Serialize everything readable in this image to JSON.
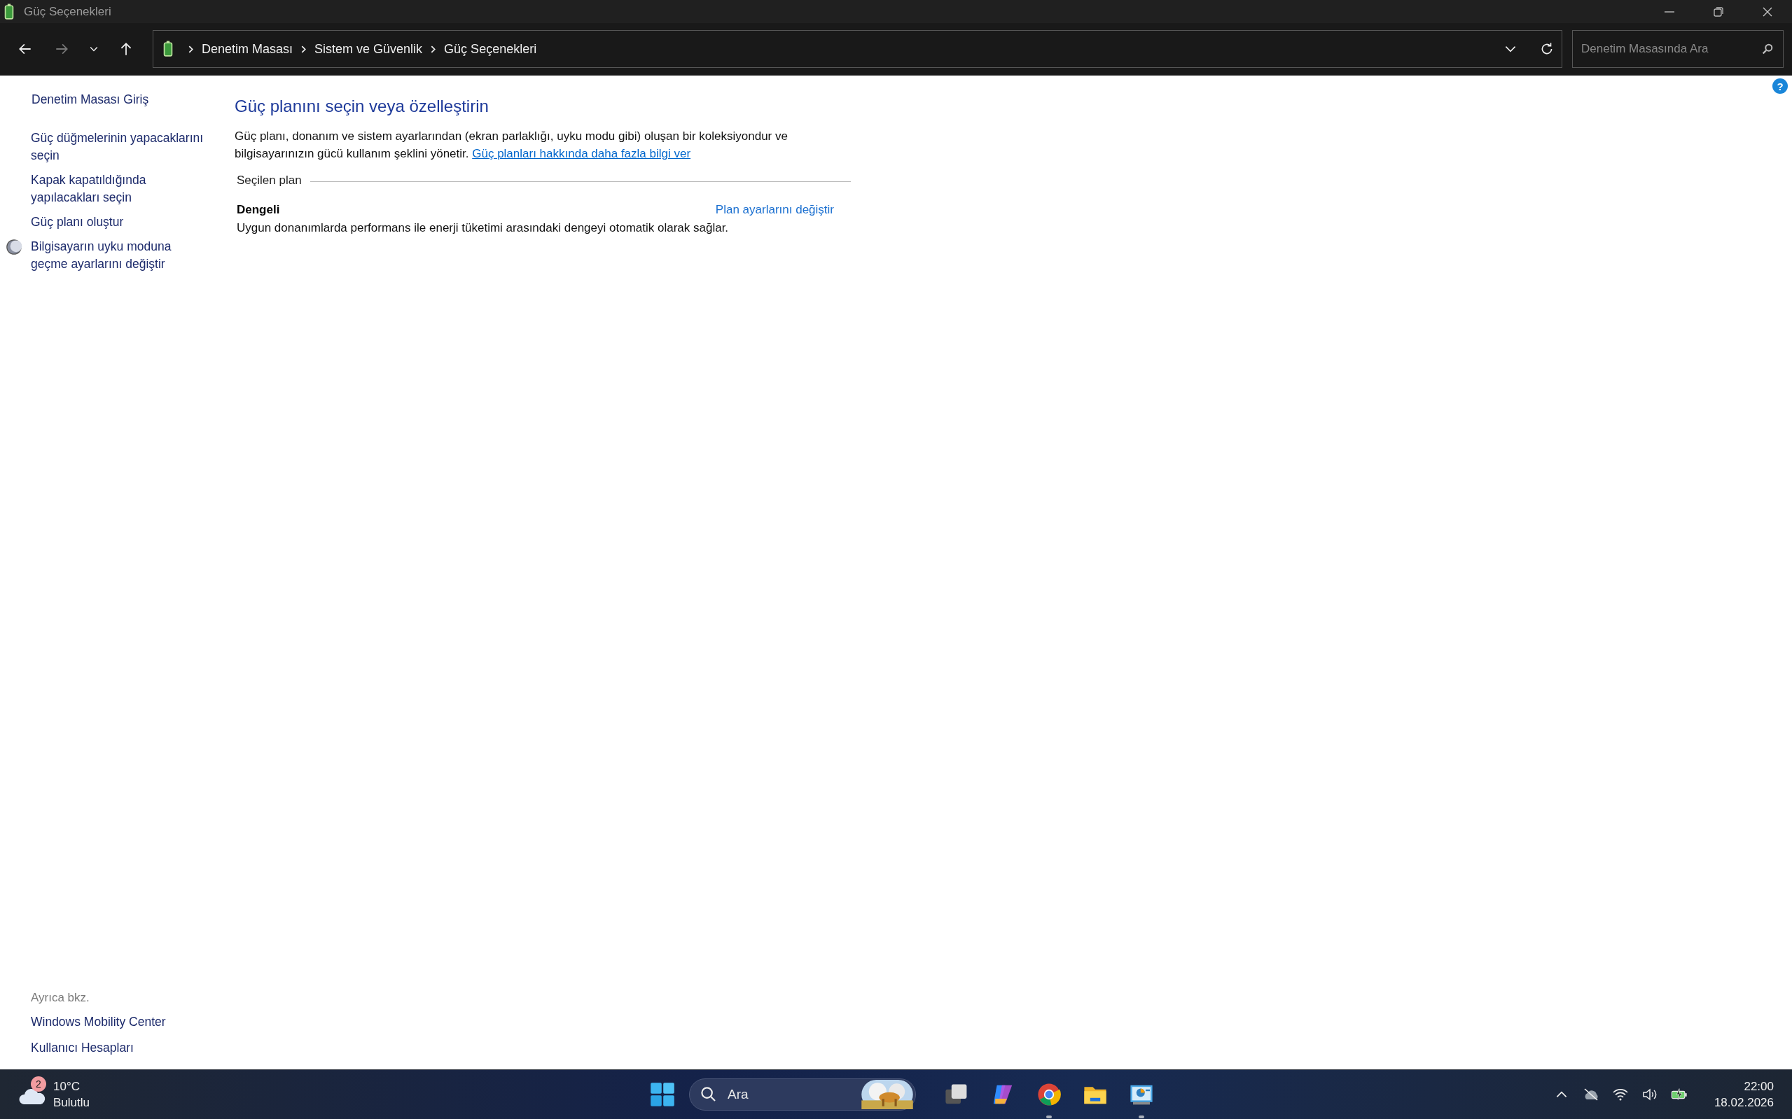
{
  "window": {
    "title": "Güç Seçenekleri"
  },
  "nav": {
    "forward_disabled": true,
    "breadcrumb": [
      "Denetim Masası",
      "Sistem ve Güvenlik",
      "Güç Seçenekleri"
    ],
    "search": {
      "placeholder": "Denetim Masasında Ara"
    }
  },
  "help": "?",
  "sidebar": {
    "items": [
      {
        "label": "Denetim Masası Giriş",
        "kind": "home"
      },
      {
        "label": "Güç düğmelerinin yapacaklarını seçin",
        "kind": "link"
      },
      {
        "label": "Kapak kapatıldığında yapılacakları seçin",
        "kind": "link"
      },
      {
        "label": "Güç planı oluştur",
        "kind": "link"
      },
      {
        "label": "Bilgisayarın uyku moduna geçme ayarlarını değiştir",
        "kind": "sleep"
      }
    ],
    "see_also": {
      "heading": "Ayrıca bkz.",
      "links": [
        "Windows Mobility Center",
        "Kullanıcı Hesapları"
      ]
    }
  },
  "main": {
    "heading": "Güç planını seçin veya özelleştirin",
    "description": "Güç planı, donanım ve sistem ayarlarından (ekran parlaklığı, uyku modu gibi) oluşan bir koleksiyondur ve bilgisayarınızın gücü kullanım şeklini yönetir.",
    "learn_more": "Güç planları hakkında daha fazla bilgi ver",
    "section": "Seçilen plan",
    "plan": {
      "name": "Dengeli",
      "change_link": "Plan ayarlarını değiştir",
      "description": "Uygun donanımlarda performans ile enerji tüketimi arasındaki dengeyi otomatik olarak sağlar."
    }
  },
  "taskbar": {
    "weather": {
      "badge": "2",
      "temperature": "10°C",
      "condition": "Bulutlu"
    },
    "search": {
      "placeholder": "Ara"
    },
    "apps": [
      {
        "kind": "task-view",
        "running": false
      },
      {
        "kind": "copilot",
        "running": false
      },
      {
        "kind": "browser",
        "running": true
      },
      {
        "kind": "folder",
        "running": false
      },
      {
        "kind": "control-panel",
        "running": true
      }
    ],
    "clock": {
      "time": "22:00",
      "date": "18.02.2026"
    }
  }
}
